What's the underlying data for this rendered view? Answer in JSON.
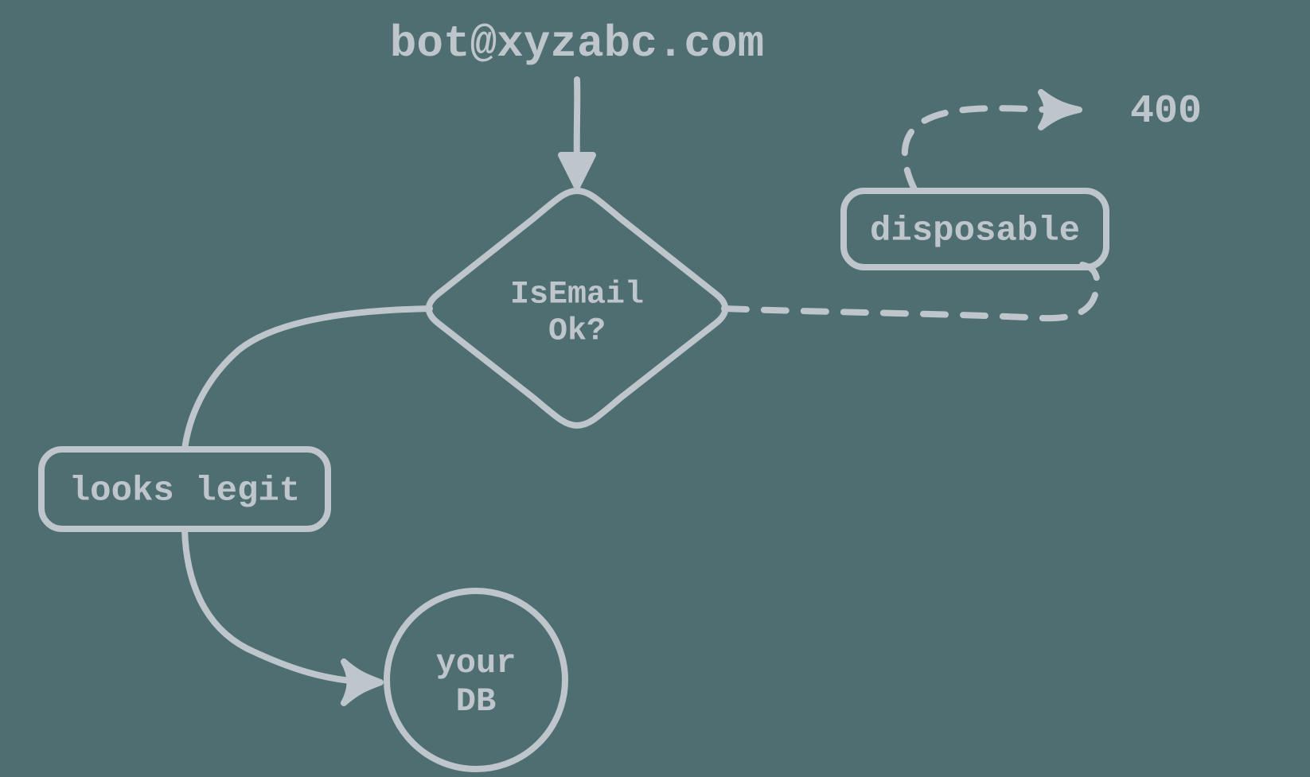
{
  "title_email": "bot@xyzabc.com",
  "decision": {
    "line1": "IsEmail",
    "line2": "Ok?"
  },
  "legit_label": "looks legit",
  "disposable_label": "disposable",
  "error_code": "400",
  "db": {
    "line1": "your",
    "line2": "DB"
  }
}
